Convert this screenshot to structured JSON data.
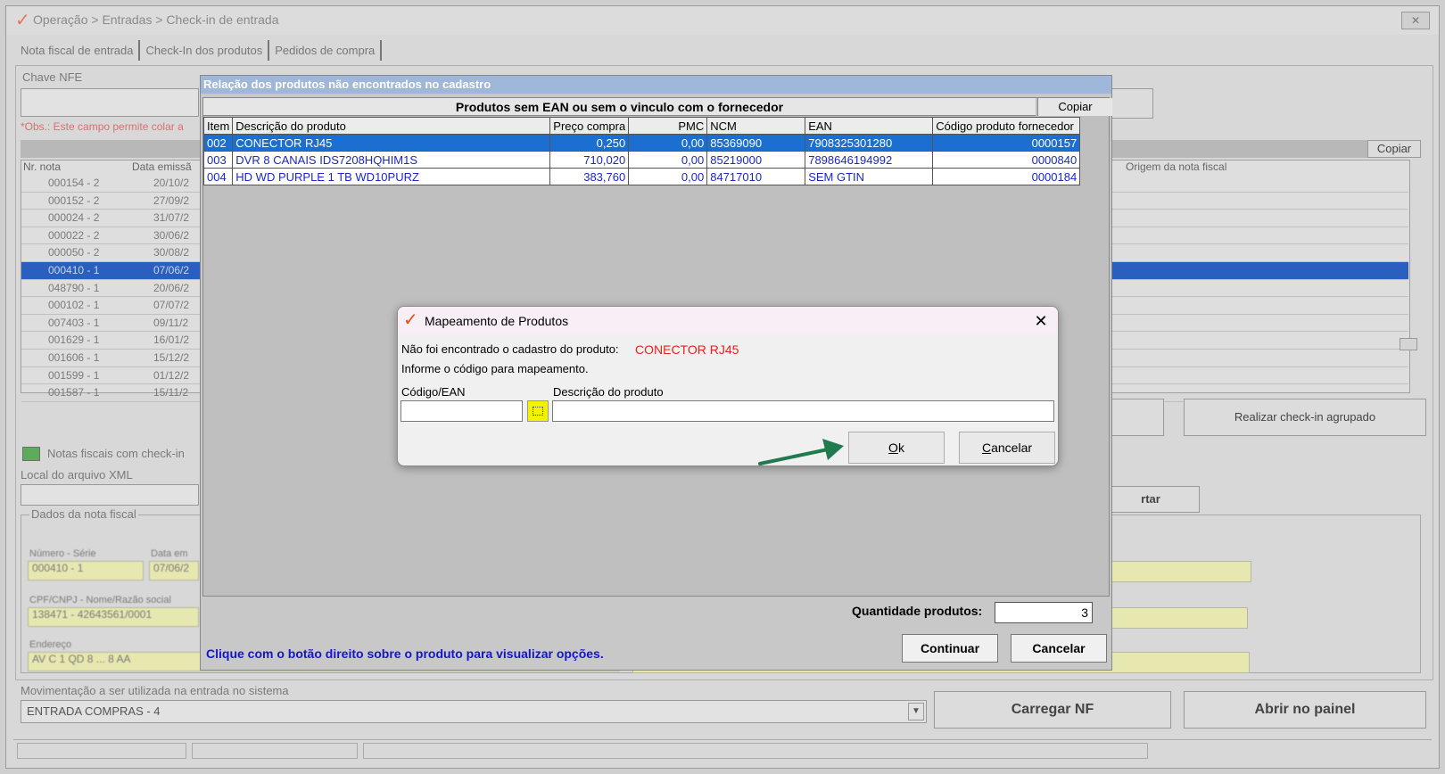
{
  "window": {
    "title": "Operação > Entradas > Check-in de entrada"
  },
  "tabs": [
    "Nota fiscal de entrada",
    "Check-In dos produtos",
    "Pedidos de compra"
  ],
  "nfe": {
    "chave_label": "Chave NFE",
    "obs": "*Obs.: Este campo permite colar a",
    "copy_label": "Copiar",
    "columns": [
      "Nr. nota",
      "Data emissã",
      "Origem da nota fiscal"
    ],
    "rows": [
      {
        "nota": "000154 - 2",
        "data": "20/10/2"
      },
      {
        "nota": "000152 - 2",
        "data": "27/09/2"
      },
      {
        "nota": "000024 - 2",
        "data": "31/07/2"
      },
      {
        "nota": "000022 - 2",
        "data": "30/06/2"
      },
      {
        "nota": "000050 - 2",
        "data": "30/08/2"
      },
      {
        "nota": "000410 - 1",
        "data": "07/06/2",
        "selected": true
      },
      {
        "nota": "048790 - 1",
        "data": "20/06/2"
      },
      {
        "nota": "000102 - 1",
        "data": "07/07/2"
      },
      {
        "nota": "007403 - 1",
        "data": "09/11/2"
      },
      {
        "nota": "001629 - 1",
        "data": "16/01/2"
      },
      {
        "nota": "001606 - 1",
        "data": "15/12/2"
      },
      {
        "nota": "001599 - 1",
        "data": "01/12/2"
      },
      {
        "nota": "001587 - 1",
        "data": "15/11/2"
      }
    ],
    "checkin_legend": "Notas fiscais com check-in",
    "grouped_checkin_btn": "Realizar check-in agrupado",
    "import_btn_partial": "rtar",
    "xml_label": "Local do arquivo XML",
    "dados_label": "Dados da nota fiscal",
    "numero_label": "Número - Série",
    "numero_value": "000410 - 1",
    "data_label": "Data em",
    "data_value": "07/06/2",
    "cpf_label": "CPF/CNPJ - Nome/Razão social",
    "cpf_value": "138471 - 42643561/0001",
    "endereco_label": "Endereço",
    "endereco_value": "AV C 1 QD 8 ... 8 AA",
    "mov_label": "Movimentação a ser utilizada na entrada no sistema",
    "mov_value": "ENTRADA COMPRAS - 4",
    "carregar_btn": "Carregar NF",
    "abrir_btn": "Abrir no painel"
  },
  "relacao": {
    "title": "Relação dos produtos não encontrados no cadastro",
    "header": "Produtos sem EAN ou sem o vinculo com o fornecedor",
    "copy_label": "Copiar",
    "columns": [
      "Item",
      "Descrição do produto",
      "Preço compra",
      "PMC",
      "NCM",
      "EAN",
      "Código produto fornecedor"
    ],
    "rows": [
      {
        "item": "002",
        "desc": "CONECTOR RJ45",
        "preco": "0,250",
        "pmc": "0,00",
        "ncm": "85369090",
        "ean": "7908325301280",
        "codigo": "0000157",
        "selected": true
      },
      {
        "item": "003",
        "desc": "DVR 8 CANAIS IDS7208HQHIM1S",
        "preco": "710,020",
        "pmc": "0,00",
        "ncm": "85219000",
        "ean": "7898646194992",
        "codigo": "0000840"
      },
      {
        "item": "004",
        "desc": "HD WD PURPLE 1 TB WD10PURZ",
        "preco": "383,760",
        "pmc": "0,00",
        "ncm": "84717010",
        "ean": "SEM GTIN",
        "codigo": "0000184"
      }
    ],
    "qty_label": "Quantidade produtos:",
    "qty_value": "3",
    "hint": "Clique com o botão direito sobre o produto para visualizar opções.",
    "continuar_btn": "Continuar",
    "cancelar_btn": "Cancelar"
  },
  "modal": {
    "title": "Mapeamento de Produtos",
    "msg_prefix": "Não foi encontrado o cadastro do produto:",
    "product_name": "CONECTOR RJ45",
    "msg_line2": "Informe o código para mapeamento.",
    "codigo_label": "Código/EAN",
    "codigo_value": "",
    "descricao_label": "Descrição do produto",
    "descricao_value": "",
    "ok_btn": "Ok",
    "cancelar_btn": "Cancelar"
  },
  "colors": {
    "accent_red": "#e8221b",
    "selection_blue": "#1b6fd1",
    "annotation_arrow": "#1f7a4d"
  }
}
